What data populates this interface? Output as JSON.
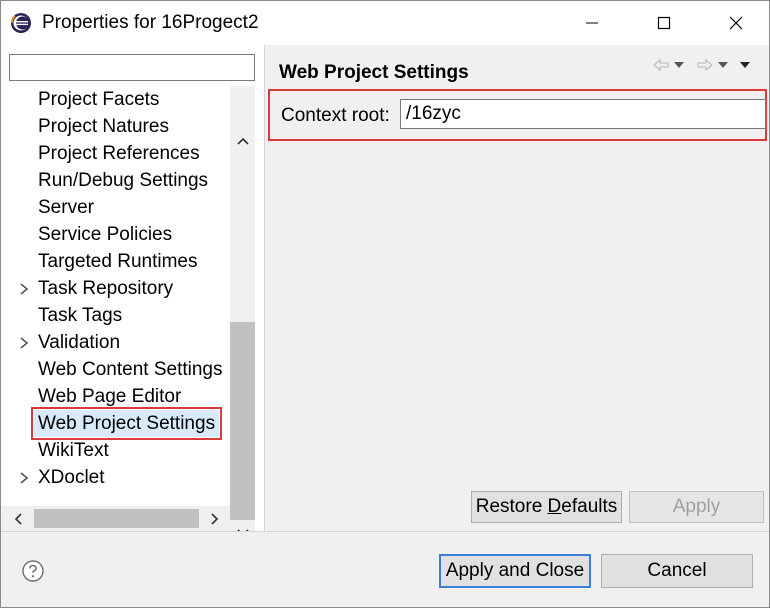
{
  "window": {
    "title": "Properties for 16Progect2"
  },
  "sidebar": {
    "filter_placeholder": "",
    "items": [
      {
        "label": "Project Facets",
        "expandable": false,
        "selected": false
      },
      {
        "label": "Project Natures",
        "expandable": false,
        "selected": false
      },
      {
        "label": "Project References",
        "expandable": false,
        "selected": false
      },
      {
        "label": "Run/Debug Settings",
        "expandable": false,
        "selected": false
      },
      {
        "label": "Server",
        "expandable": false,
        "selected": false
      },
      {
        "label": "Service Policies",
        "expandable": false,
        "selected": false
      },
      {
        "label": "Targeted Runtimes",
        "expandable": false,
        "selected": false
      },
      {
        "label": "Task Repository",
        "expandable": true,
        "selected": false
      },
      {
        "label": "Task Tags",
        "expandable": false,
        "selected": false
      },
      {
        "label": "Validation",
        "expandable": true,
        "selected": false
      },
      {
        "label": "Web Content Settings",
        "expandable": false,
        "selected": false
      },
      {
        "label": "Web Page Editor",
        "expandable": false,
        "selected": false
      },
      {
        "label": "Web Project Settings",
        "expandable": false,
        "selected": true
      },
      {
        "label": "WikiText",
        "expandable": false,
        "selected": false
      },
      {
        "label": "XDoclet",
        "expandable": true,
        "selected": false
      }
    ]
  },
  "main": {
    "page_title": "Web Project Settings",
    "context_root_label": "Context root:",
    "context_root_value": "/16zyc",
    "restore_defaults_prefix": "Restore ",
    "restore_defaults_mnemonic": "D",
    "restore_defaults_suffix": "efaults",
    "apply_label": "Apply"
  },
  "footer": {
    "apply_close_label": "Apply and Close",
    "cancel_label": "Cancel"
  },
  "colors": {
    "highlight_border": "#d93a3a",
    "default_button_border": "#3c7fd6",
    "disabled_text": "#a0a0a0"
  },
  "icons": {
    "app": "eclipse-icon",
    "help": "help-icon",
    "nav_back": "back-arrow-icon",
    "nav_forward": "forward-arrow-icon",
    "view_menu": "view-menu-icon"
  }
}
